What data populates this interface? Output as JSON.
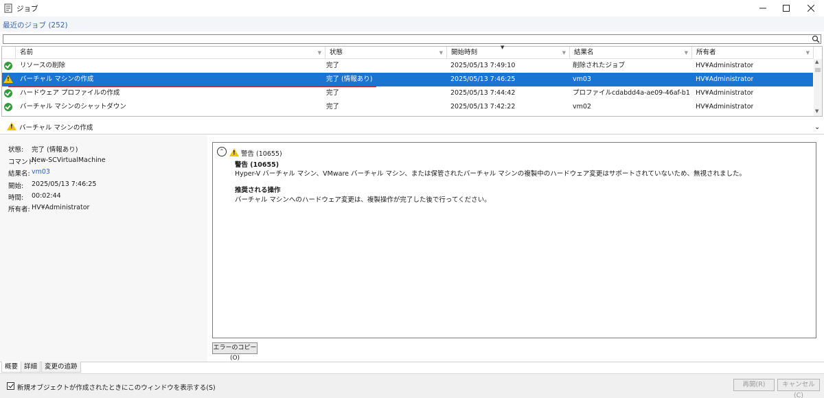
{
  "window": {
    "title": "ジョブ"
  },
  "recent": {
    "title": "最近のジョブ (252)"
  },
  "search": {
    "placeholder": ""
  },
  "grid": {
    "columns": [
      "名前",
      "状態",
      "開始時刻",
      "結果名",
      "所有者"
    ],
    "sorted_column": "開始時刻",
    "rows": [
      {
        "status_icon": "success-icon",
        "name": "リソースの削除",
        "state": "完了",
        "start": "2025/05/13 7:49:10",
        "result": "削除されたジョブ",
        "owner": "HV¥Administrator"
      },
      {
        "status_icon": "warning-icon",
        "name": "バーチャル マシンの作成",
        "state": "完了 (情報あり)",
        "start": "2025/05/13 7:46:25",
        "result": "vm03",
        "owner": "HV¥Administrator",
        "selected": true
      },
      {
        "status_icon": "success-icon",
        "name": "ハードウェア プロファイルの作成",
        "state": "完了",
        "start": "2025/05/13 7:44:42",
        "result": "プロファイルcdabdd4a-ae09-46af-b16b-b...",
        "owner": "HV¥Administrator"
      },
      {
        "status_icon": "success-icon",
        "name": "バーチャル マシンのシャットダウン",
        "state": "完了",
        "start": "2025/05/13 7:42:22",
        "result": "vm02",
        "owner": "HV¥Administrator"
      }
    ]
  },
  "detail": {
    "title": "バーチャル マシンの作成",
    "fields": [
      {
        "label": "状態:",
        "value": "完了 (情報あり)"
      },
      {
        "label": "コマンド:",
        "value": "New-SCVirtualMachine"
      },
      {
        "label": "結果名:",
        "value": "vm03"
      },
      {
        "label": "開始:",
        "value": "2025/05/13 7:46:25"
      },
      {
        "label": "時間:",
        "value": "00:02:44"
      },
      {
        "label": "所有者:",
        "value": "HV¥Administrator"
      }
    ],
    "message": {
      "header": "警告 (10655)",
      "title": "警告 (10655)",
      "body": "Hyper-V バーチャル マシン、VMware バーチャル マシン、または保管されたバーチャル マシンの複製中のハードウェア変更はサポートされていないため、無視されました。",
      "action_title": "推奨される操作",
      "action_body": "バーチャル マシンへのハードウェア変更は、複製操作が完了した後で行ってください。"
    },
    "copy_button": "エラーのコピー(O)"
  },
  "tabs": [
    "概要",
    "詳細",
    "変更の追跡"
  ],
  "footer": {
    "checkbox_label": "新規オブジェクトが作成されたときにこのウィンドウを表示する(S)",
    "checkbox_checked": true,
    "restart_button": "再開(R)",
    "cancel_button": "キャンセル(C)"
  }
}
